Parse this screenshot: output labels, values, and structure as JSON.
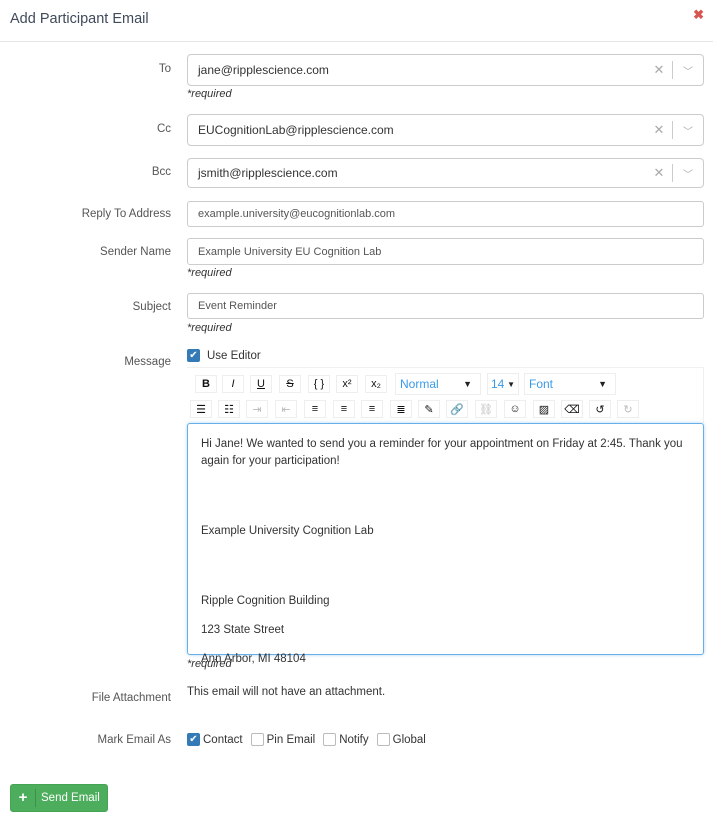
{
  "modal": {
    "title": "Add Participant Email",
    "close_icon": "close-icon"
  },
  "fields": {
    "to": {
      "label": "To",
      "value": "jane@ripplescience.com",
      "required": "*required"
    },
    "cc": {
      "label": "Cc",
      "value": "EUCognitionLab@ripplescience.com"
    },
    "bcc": {
      "label": "Bcc",
      "value": "jsmith@ripplescience.com"
    },
    "reply_to": {
      "label": "Reply To Address",
      "value": "example.university@eucognitionlab.com"
    },
    "sender": {
      "label": "Sender Name",
      "value": "Example University EU Cognition Lab",
      "required": "*required"
    },
    "subject": {
      "label": "Subject",
      "value": "Event Reminder",
      "required": "*required"
    },
    "message": {
      "label": "Message",
      "use_editor": "Use Editor",
      "use_editor_checked": true,
      "required": "*required",
      "format": "Normal",
      "size": "14",
      "font": "Font",
      "body": [
        "Hi Jane! We wanted to send you a reminder for your appointment on Friday at 2:45. Thank you again for your participation!",
        "",
        "Example University Cognition Lab",
        "",
        "Ripple Cognition Building",
        "123 State Street",
        "Ann Arbor, MI 48104"
      ]
    },
    "attachment": {
      "label": "File Attachment",
      "value": "This email will not have an attachment."
    },
    "mark": {
      "label": "Mark Email As",
      "options": [
        {
          "label": "Contact",
          "checked": true
        },
        {
          "label": "Pin Email",
          "checked": false
        },
        {
          "label": "Notify",
          "checked": false
        },
        {
          "label": "Global",
          "checked": false
        }
      ]
    }
  },
  "toolbar": {
    "row1": [
      {
        "name": "bold",
        "glyph": "B"
      },
      {
        "name": "italic",
        "glyph": "I"
      },
      {
        "name": "underline",
        "glyph": "U"
      },
      {
        "name": "strikethrough",
        "glyph": "S"
      },
      {
        "name": "code",
        "glyph": "{ }"
      },
      {
        "name": "superscript",
        "glyph": "x²"
      },
      {
        "name": "subscript",
        "glyph": "x₂"
      }
    ],
    "row2": [
      {
        "name": "bullet-list",
        "glyph": "☰"
      },
      {
        "name": "numbered-list",
        "glyph": "☷"
      },
      {
        "name": "indent",
        "glyph": "⇥",
        "disabled": true
      },
      {
        "name": "outdent",
        "glyph": "⇤",
        "disabled": true
      },
      {
        "name": "align-left",
        "glyph": "≡"
      },
      {
        "name": "align-center",
        "glyph": "≡"
      },
      {
        "name": "align-right",
        "glyph": "≡"
      },
      {
        "name": "justify",
        "glyph": "≣"
      },
      {
        "name": "color",
        "glyph": "✎"
      },
      {
        "name": "link",
        "glyph": "🔗"
      },
      {
        "name": "unlink",
        "glyph": "⛓",
        "disabled": true
      },
      {
        "name": "emoji",
        "glyph": "☺"
      },
      {
        "name": "image",
        "glyph": "▨"
      },
      {
        "name": "eraser",
        "glyph": "⌫"
      },
      {
        "name": "undo",
        "glyph": "↺"
      },
      {
        "name": "redo",
        "glyph": "↻",
        "disabled": true
      }
    ]
  },
  "actions": {
    "send": "Send Email"
  },
  "colors": {
    "primary": "#337ab7",
    "success": "#4cae5c",
    "close": "#d9534f",
    "focus": "#66afe9"
  }
}
